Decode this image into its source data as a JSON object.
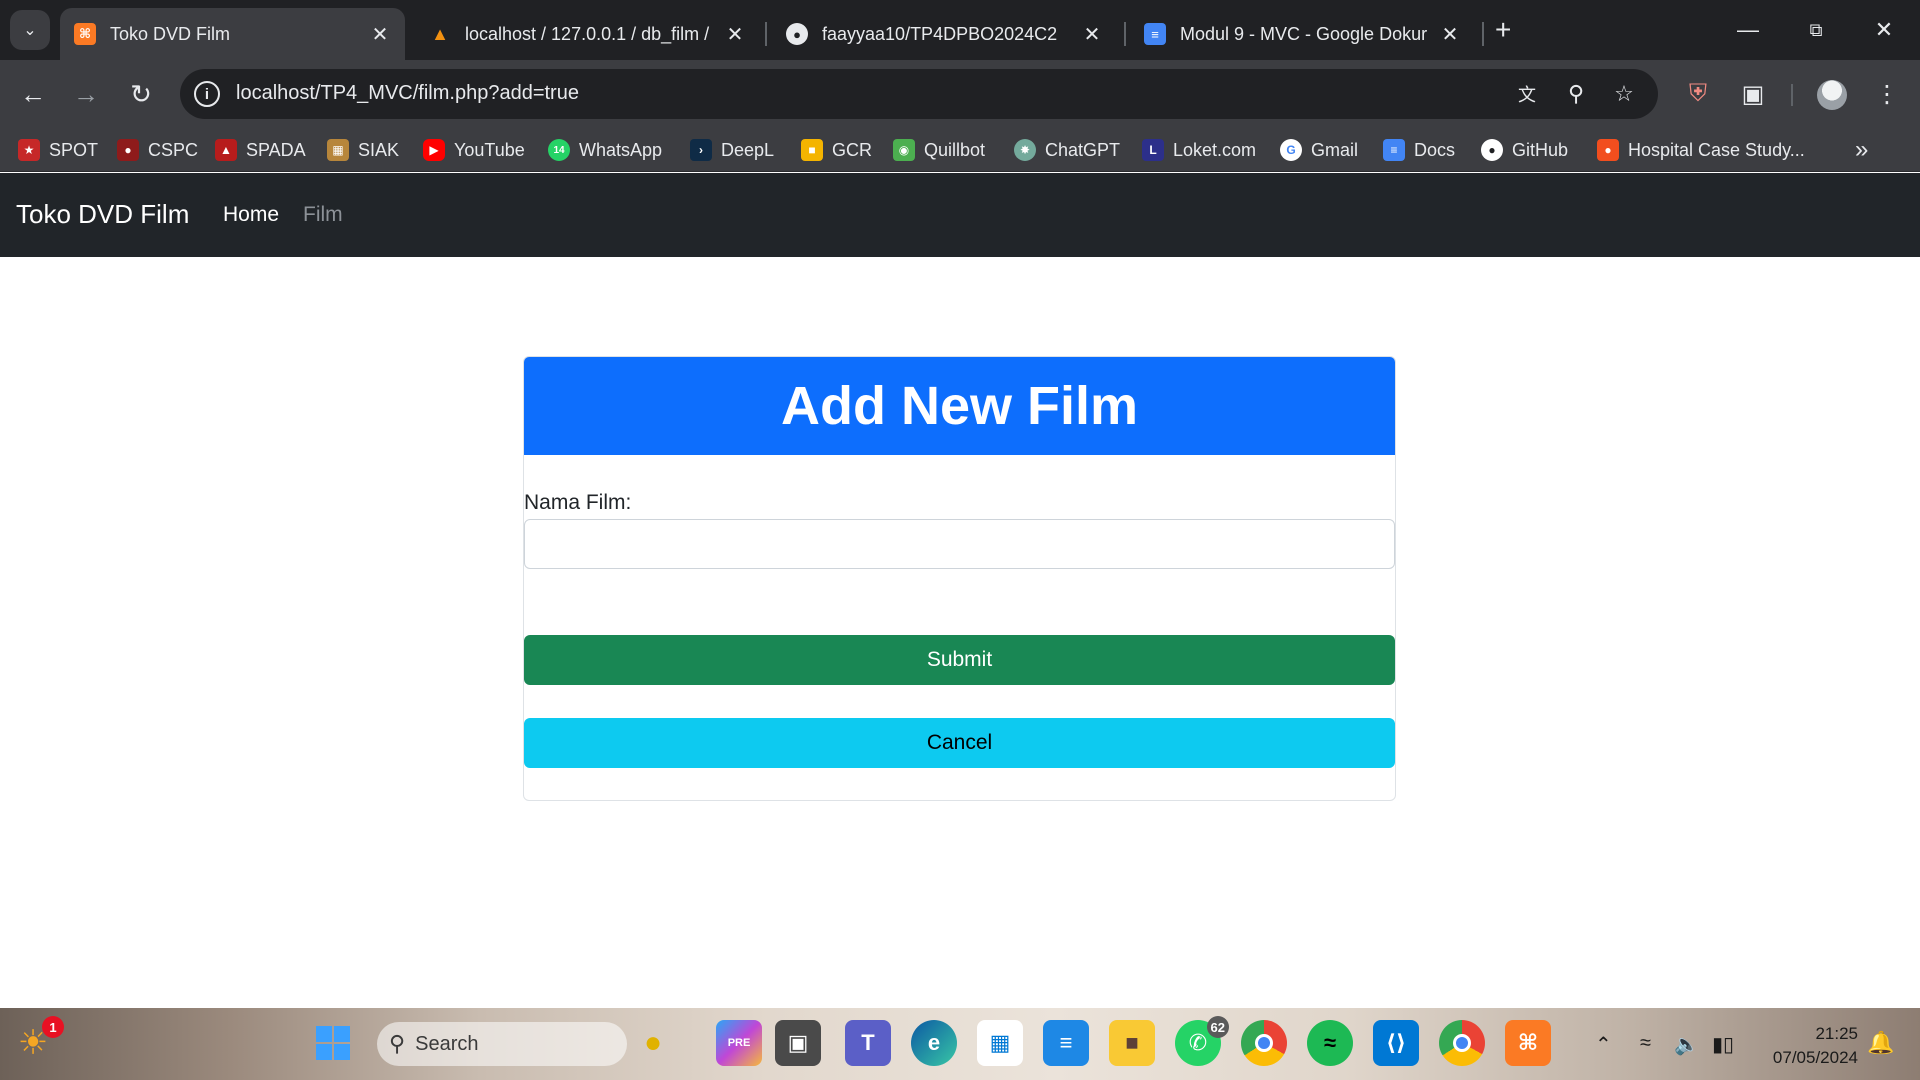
{
  "browser": {
    "tabs": [
      {
        "title": "Toko DVD Film",
        "icon": "xampp-icon",
        "active": true
      },
      {
        "title": "localhost / 127.0.0.1 / db_film /",
        "icon": "phpmyadmin-icon",
        "active": false
      },
      {
        "title": "faayyaa10/TP4DPBO2024C2",
        "icon": "github-icon",
        "active": false
      },
      {
        "title": "Modul 9 - MVC - Google Dokur",
        "icon": "google-docs-icon",
        "active": false
      }
    ],
    "url": "localhost/TP4_MVC/film.php?add=true",
    "bookmarks": [
      {
        "label": "SPOT",
        "color": "#c62828"
      },
      {
        "label": "CSPC",
        "color": "#8e1b1b"
      },
      {
        "label": "SPADA",
        "color": "#b71c1c"
      },
      {
        "label": "SIAK",
        "color": "#b7863b"
      },
      {
        "label": "YouTube",
        "color": "#ff0000"
      },
      {
        "label": "WhatsApp",
        "color": "#25d366"
      },
      {
        "label": "DeepL",
        "color": "#0f2b46"
      },
      {
        "label": "GCR",
        "color": "#f4b400"
      },
      {
        "label": "Quillbot",
        "color": "#4caf50"
      },
      {
        "label": "ChatGPT",
        "color": "#74aa9c"
      },
      {
        "label": "Loket.com",
        "color": "#2c2f8a"
      },
      {
        "label": "Gmail",
        "color": "#ffffff"
      },
      {
        "label": "Docs",
        "color": "#4285f4"
      },
      {
        "label": "GitHub",
        "color": "#ffffff"
      },
      {
        "label": "Hospital Case Study...",
        "color": "#f24e1e"
      }
    ],
    "whatsapp_badge": "14"
  },
  "site": {
    "brand": "Toko DVD Film",
    "nav": {
      "home": "Home",
      "film": "Film"
    }
  },
  "form": {
    "heading": "Add New Film",
    "label": "Nama Film:",
    "input_value": "",
    "submit": "Submit",
    "cancel": "Cancel",
    "colors": {
      "header": "#0d6efd",
      "submit": "#198754",
      "cancel": "#0dcaf0",
      "navbar": "#212529"
    }
  },
  "taskbar": {
    "search_placeholder": "Search",
    "weather_badge": "1",
    "whatsapp_badge": "62",
    "time": "21:25",
    "date": "07/05/2024"
  }
}
